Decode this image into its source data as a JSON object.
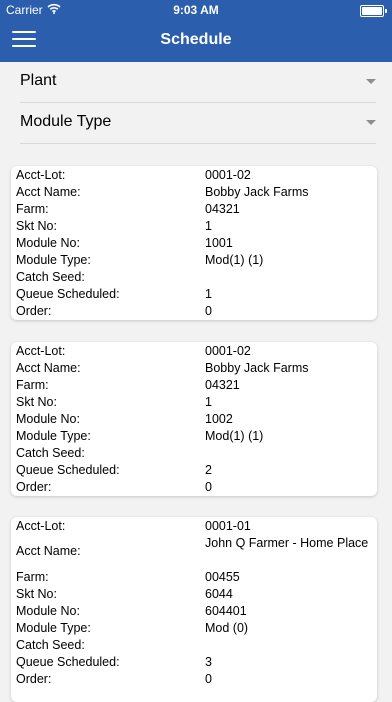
{
  "status_bar": {
    "carrier": "Carrier",
    "time": "9:03 AM"
  },
  "nav": {
    "title": "Schedule"
  },
  "filters": {
    "plant_label": "Plant",
    "module_type_label": "Module Type"
  },
  "field_labels": {
    "acct_lot": "Acct-Lot:",
    "acct_name": "Acct Name:",
    "farm": "Farm:",
    "skt_no": "Skt No:",
    "module_no": "Module No:",
    "module_type": "Module Type:",
    "catch_seed": "Catch Seed:",
    "queue_scheduled": "Queue Scheduled:",
    "order": "Order:"
  },
  "cards": [
    {
      "acct_lot": "0001-02",
      "acct_name": "Bobby Jack Farms",
      "farm": "04321",
      "skt_no": "1",
      "module_no": "1001",
      "module_type": "Mod(1) (1)",
      "catch_seed": "",
      "queue_scheduled": "1",
      "order": "0"
    },
    {
      "acct_lot": "0001-02",
      "acct_name": "Bobby Jack Farms",
      "farm": "04321",
      "skt_no": "1",
      "module_no": "1002",
      "module_type": "Mod(1) (1)",
      "catch_seed": "",
      "queue_scheduled": "2",
      "order": "0"
    },
    {
      "acct_lot": "0001-01",
      "acct_name": "John Q Farmer - Home Place",
      "farm": "00455",
      "skt_no": "6044",
      "module_no": "604401",
      "module_type": "Mod (0)",
      "catch_seed": "",
      "queue_scheduled": "3",
      "order": "0"
    }
  ]
}
